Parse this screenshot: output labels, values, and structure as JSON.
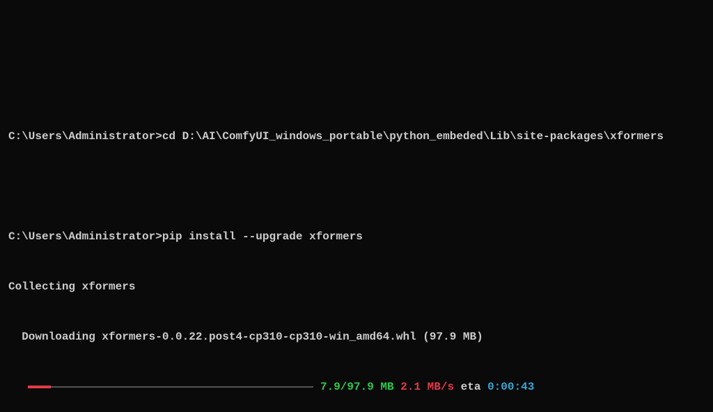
{
  "lines": {
    "line1_prompt": "C:\\Users\\Administrator>",
    "line1_cmd": "cd D:\\AI\\ComfyUI_windows_portable\\python_embeded\\Lib\\site-packages\\xformers",
    "line2_prompt": "C:\\Users\\Administrator>",
    "line2_cmd": "pip install --upgrade xformers",
    "line3": "Collecting xformers",
    "line4": "  Downloading xformers-0.0.22.post4-cp310-cp310-win_amd64.whl (97.9 MB)"
  },
  "progress": {
    "size": "7.9/97.9 MB",
    "speed": "2.1 MB/s",
    "eta_label": "eta",
    "eta_value": "0:00:43"
  }
}
